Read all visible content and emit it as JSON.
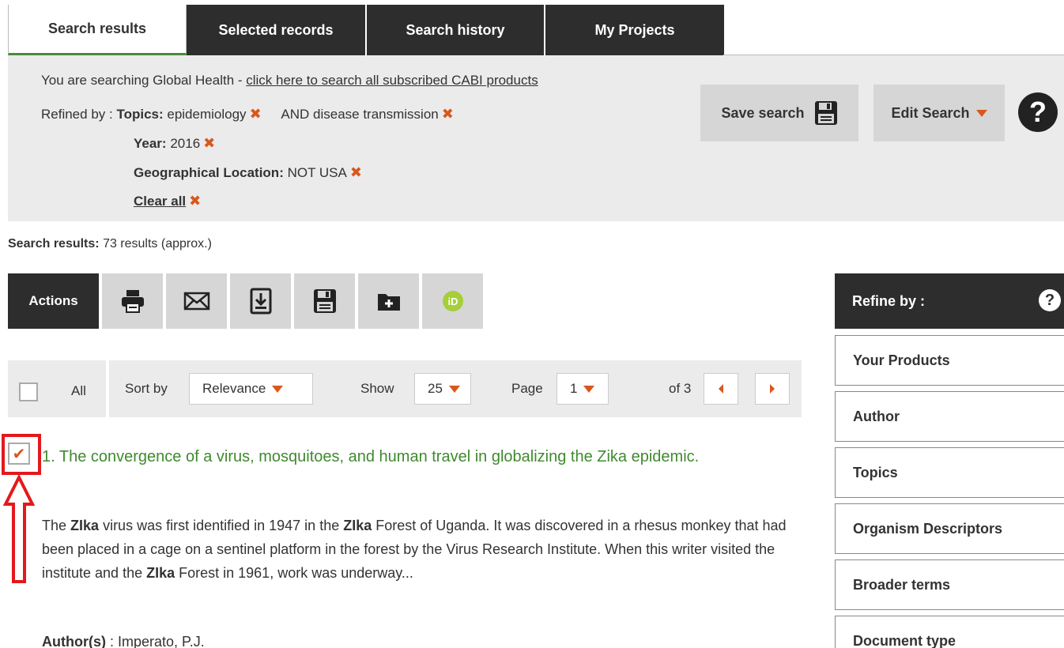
{
  "tabs": [
    {
      "label": "Search results"
    },
    {
      "label": "Selected records"
    },
    {
      "label": "Search history"
    },
    {
      "label": "My Projects"
    }
  ],
  "search_panel": {
    "intro": "You are searching Global Health - ",
    "link": "click here to search all subscribed CABI products",
    "refined_by_label": "Refined by : ",
    "topics_label": "Topics:",
    "topic_1": "epidemiology",
    "topic_2": "AND disease transmission",
    "year_label": "Year:",
    "year_value": "2016",
    "geo_label": "Geographical Location:",
    "geo_value": "NOT USA",
    "clear_all": "Clear all",
    "save_search": "Save search",
    "edit_search": "Edit Search",
    "help": "?"
  },
  "results_summary": {
    "label": "Search results:",
    "text": "73 results (approx.)"
  },
  "actions": {
    "label": "Actions",
    "buttons": [
      "print-icon",
      "email-icon",
      "download-icon",
      "save-icon",
      "add-folder-icon",
      "orcid-icon"
    ]
  },
  "sortbar": {
    "all": "All",
    "sort_by": "Sort by",
    "sort_value": "Relevance",
    "show": "Show",
    "show_value": "25",
    "page": "Page",
    "page_value": "1",
    "of": "of 3"
  },
  "result": {
    "title": "1. The convergence of a virus, mosquitoes, and human travel in globalizing the Zika epidemic.",
    "abstract_parts": [
      "The ",
      "ZIka",
      " virus was first identified in 1947 in the ",
      "ZIka",
      " Forest of Uganda. It was discovered in a rhesus monkey that had been placed in a cage on a sentinel platform in the forest by the Virus Research Institute. When this writer visited the institute and the ",
      "ZIka",
      " Forest in 1961, work was underway..."
    ],
    "author_label": "Author(s)",
    "author_value": " : Imperato, P.J."
  },
  "refine": {
    "title": "Refine by :",
    "help": "?",
    "items": [
      "Your Products",
      "Author",
      "Topics",
      "Organism Descriptors",
      "Broader terms",
      "Document type"
    ]
  },
  "colors": {
    "dark": "#2d2d2d",
    "panel": "#ebebeb",
    "accent_orange": "#d9571c",
    "title_green": "#3f8a2e",
    "highlight_red": "#e3191c"
  }
}
